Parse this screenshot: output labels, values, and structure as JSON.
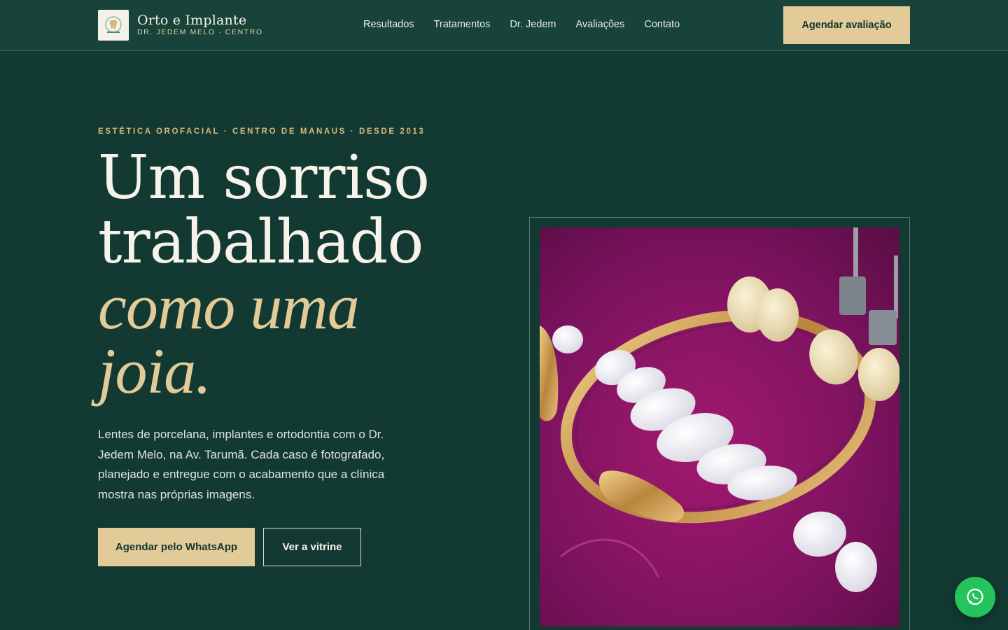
{
  "header": {
    "brand_name": "Orto e Implante",
    "brand_sub": "DR. JEDEM MELO · CENTRO",
    "logo_icon": "tooth-logo-icon",
    "nav": [
      {
        "label": "Resultados"
      },
      {
        "label": "Tratamentos"
      },
      {
        "label": "Dr. Jedem"
      },
      {
        "label": "Avaliações"
      },
      {
        "label": "Contato"
      }
    ],
    "cta_label": "Agendar avaliação"
  },
  "hero": {
    "eyebrow": "ESTÉTICA OROFACIAL · CENTRO DE MANAUS · DESDE 2013",
    "headline_line1": "Um sorriso",
    "headline_line2": "trabalhado",
    "headline_line3": "como uma",
    "headline_line4": "joia.",
    "lead": "Lentes de porcelana, implantes e ortodontia com o Dr. Jedem Melo, na Av. Tarumã. Cada caso é fotografado, planejado e entregue com o acabamento que a clínica mostra nas próprias imagens.",
    "primary_button": "Agendar pelo WhatsApp",
    "secondary_button": "Ver a vitrine",
    "image_subject": "porcelain veneers and gold bracelet on magenta surface"
  },
  "floating": {
    "whatsapp_icon": "whatsapp-icon"
  },
  "colors": {
    "background": "#123a33",
    "header": "#17433b",
    "gold": "#e2cb98",
    "accent_text": "#d8b878",
    "whatsapp": "#25c35c"
  }
}
